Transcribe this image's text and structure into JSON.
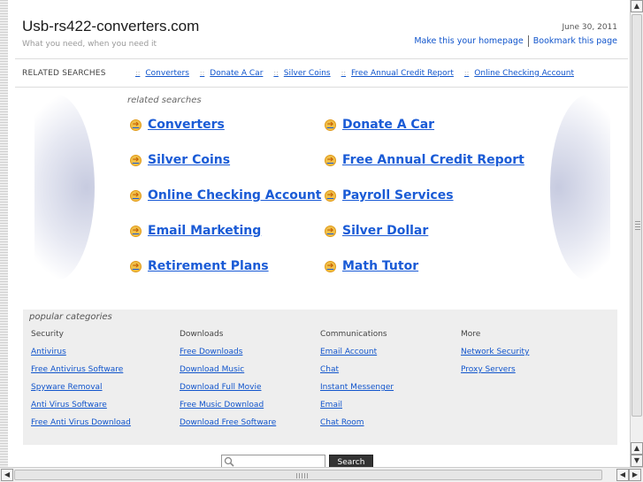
{
  "header": {
    "site_title": "Usb-rs422-converters.com",
    "tagline": "What you need, when you need it",
    "date": "June 30, 2011",
    "homepage_link": "Make this your homepage",
    "bookmark_link": "Bookmark this page"
  },
  "related_bar": {
    "label": "RELATED SEARCHES",
    "separator": "::",
    "items": [
      "Converters",
      "Donate A Car",
      "Silver Coins",
      "Free Annual Credit Report",
      "Online Checking Account"
    ]
  },
  "related_searches": {
    "heading": "related searches",
    "arrow_glyph": "➔",
    "left": [
      "Converters",
      "Silver Coins",
      "Online Checking Account",
      "Email Marketing",
      "Retirement Plans"
    ],
    "right": [
      "Donate A Car",
      "Free Annual Credit Report",
      "Payroll Services",
      "Silver Dollar",
      "Math Tutor"
    ]
  },
  "categories": {
    "heading": "popular categories",
    "columns": [
      {
        "title": "Security",
        "links": [
          "Antivirus",
          "Free Antivirus Software",
          "Spyware Removal",
          "Anti Virus Software",
          "Free Anti Virus Download"
        ]
      },
      {
        "title": "Downloads",
        "links": [
          "Free Downloads",
          "Download Music",
          "Download Full Movie",
          "Free Music Download",
          "Download Free Software"
        ]
      },
      {
        "title": "Communications",
        "links": [
          "Email Account",
          "Chat",
          "Instant Messenger",
          "Email",
          "Chat Room"
        ]
      },
      {
        "title": "More",
        "links": [
          "Network Security",
          "Proxy Servers"
        ]
      }
    ]
  },
  "search": {
    "placeholder": "",
    "button_label": "Search"
  },
  "colors": {
    "link": "#1155cc",
    "panel_bg": "#eeeeee",
    "search_button": "#333333"
  },
  "icons": {
    "search": "magnifier-icon",
    "bullet": "arrow-circle-icon"
  }
}
